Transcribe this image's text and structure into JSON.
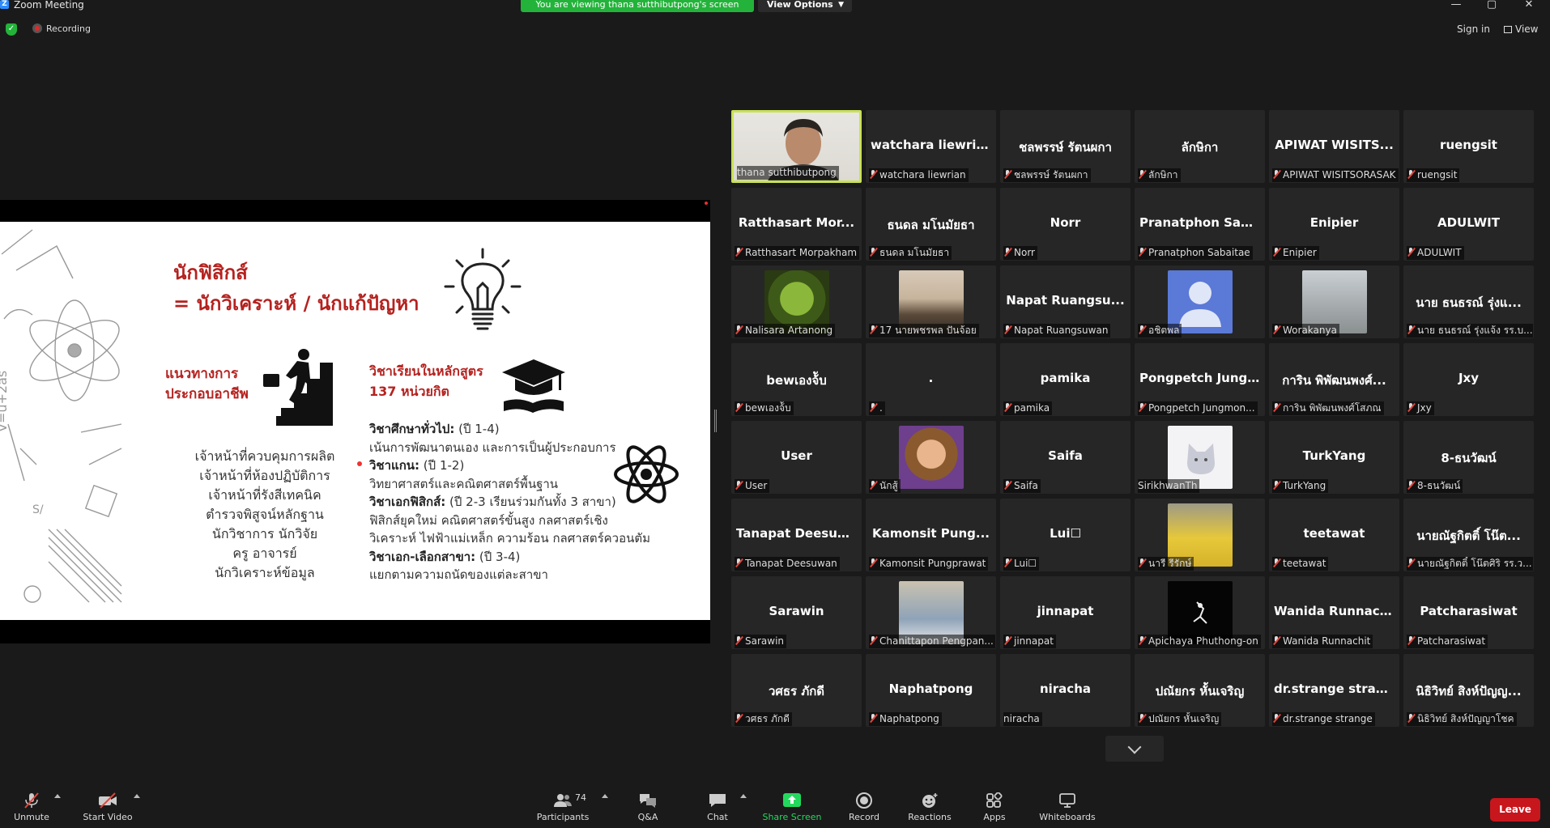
{
  "window": {
    "app_title": "Zoom Meeting",
    "minimize": "—",
    "restore": "▢",
    "close": "✕"
  },
  "banner": {
    "viewing": "You are viewing thana sutthibutpong's screen",
    "view_options": "View Options"
  },
  "topbar": {
    "recording": "Recording",
    "sign_in": "Sign in",
    "view": "View"
  },
  "slide": {
    "title_line1": "นักฟิสิกส์",
    "title_line2": "= นักวิเคราะห์ / นักแก้ปัญหา",
    "career_heading_line1": "แนวทางการ",
    "career_heading_line2": "ประกอบอาชีพ",
    "course_heading_line1": "วิชาเรียนในหลักสูตร",
    "course_heading_line2": "137 หน่วยกิต",
    "careers": [
      "เจ้าหน้าที่ควบคุมการผลิต",
      "เจ้าหน้าที่ห้องปฏิบัติการ",
      "เจ้าหน้าที่รังสีเทคนิค",
      "ตำรวจพิสูจน์หลักฐาน",
      "นักวิชาการ นักวิจัย",
      "ครู อาจารย์",
      "นักวิเคราะห์ข้อมูล"
    ],
    "curriculum": {
      "general_label": "วิชาศึกษาทั่วไป:",
      "general_years": " (ปี 1-4)",
      "general_desc": "เน้นการพัฒนาตนเอง และการเป็นผู้ประกอบการ",
      "core_label": "วิชาแกน:",
      "core_years": " (ปี 1-2)",
      "core_desc": "วิทยาศาสตร์และคณิตศาสตร์พื้นฐาน",
      "major_label": "วิชาเอกฟิสิกส์:",
      "major_years": " (ปี 2-3 เรียนร่วมกันทั้ง 3 สาขา)",
      "major_desc1": "ฟิสิกส์ยุคใหม่ คณิตศาสตร์ขั้นสูง กลศาสตร์เชิง",
      "major_desc2": "วิเคราะห์ ไฟฟ้าแม่เหล็ก ความร้อน กลศาสตร์ควอนตัม",
      "elective_label": "วิชาเอก-เลือกสาขา:",
      "elective_years": " (ปี 3-4)",
      "elective_desc": "แยกตามความถนัดของแต่ละสาขา"
    }
  },
  "participants_grid": [
    {
      "name": "",
      "label": "thana sutthibutpong",
      "muted": false,
      "active": true,
      "avatar": "person"
    },
    {
      "name": "watchara liewrian",
      "label": "watchara liewrian",
      "muted": true
    },
    {
      "name": "ชลพรรษ์ รัตนผกา",
      "label": "ชลพรรษ์ รัตนผกา",
      "muted": true
    },
    {
      "name": "ลักษิกา",
      "label": "ลักษิกา",
      "muted": true
    },
    {
      "name": "APIWAT WISITS...",
      "label": "APIWAT WISITSORASAK",
      "muted": true
    },
    {
      "name": "ruengsit",
      "label": "ruengsit",
      "muted": true
    },
    {
      "name": "Ratthasart Mor...",
      "label": "Ratthasart Morpakham",
      "muted": true
    },
    {
      "name": "ธนดล มโนมัยธา",
      "label": "ธนดล มโนมัยธา",
      "muted": true
    },
    {
      "name": "Norr",
      "label": "Norr",
      "muted": true
    },
    {
      "name": "Pranatphon Sab...",
      "label": "Pranatphon Sabaitae",
      "muted": true
    },
    {
      "name": "Enipier",
      "label": "Enipier",
      "muted": true
    },
    {
      "name": "ADULWIT",
      "label": "ADULWIT",
      "muted": true
    },
    {
      "name": "",
      "label": "Nalisara Artanong",
      "muted": true,
      "avatar": "green"
    },
    {
      "name": "",
      "label": "17 นายพชรพล ปันจ้อย",
      "muted": true,
      "avatar": "sunset"
    },
    {
      "name": "Napat Ruangsu...",
      "label": "Napat Ruangsuwan",
      "muted": true
    },
    {
      "name": "",
      "label": "อชิตพล",
      "muted": true,
      "avatar": "default"
    },
    {
      "name": "",
      "label": "Worakanya",
      "muted": true,
      "avatar": "birds"
    },
    {
      "name": "นาย ธนธรณ์ รุ่งแ...",
      "label": "นาย ธนธรณ์ รุ่งแจ้ง รร.บ...",
      "muted": true
    },
    {
      "name": "bewเองจ้ับ",
      "label": "bewเองจ้ับ",
      "muted": true
    },
    {
      "name": ".",
      "label": ".",
      "muted": true
    },
    {
      "name": "pamika",
      "label": "pamika",
      "muted": true
    },
    {
      "name": "Pongpetch Jung...",
      "label": "Pongpetch Jungmon...",
      "muted": true
    },
    {
      "name": "การิน พิพัฒนพงศ์...",
      "label": "การิน พิพัฒนพงศ์โสภณ",
      "muted": true
    },
    {
      "name": "Jxy",
      "label": "Jxy",
      "muted": true
    },
    {
      "name": "User",
      "label": "User",
      "muted": true
    },
    {
      "name": "",
      "label": "นักสู้",
      "muted": true,
      "avatar": "cartoon"
    },
    {
      "name": "Saifa",
      "label": "Saifa",
      "muted": true
    },
    {
      "name": "",
      "label": "SirikhwanTh",
      "muted": false,
      "avatar": "cat"
    },
    {
      "name": "TurkYang",
      "label": "TurkYang",
      "muted": true
    },
    {
      "name": "8-ธนวัฒน์",
      "label": "8-ธนวัฒน์",
      "muted": true
    },
    {
      "name": "Tanapat Deesuw...",
      "label": "Tanapat Deesuwan",
      "muted": true
    },
    {
      "name": "Kamonsit Pung...",
      "label": "Kamonsit Pungprawat",
      "muted": true
    },
    {
      "name": "Lui☐",
      "label": "Lui☐",
      "muted": true
    },
    {
      "name": "",
      "label": "นารี รีรักษ์",
      "muted": true,
      "avatar": "yellow"
    },
    {
      "name": "teetawat",
      "label": "teetawat",
      "muted": true
    },
    {
      "name": "นายณัฐกิตติ์ โน๊ต...",
      "label": "นายณัฐกิตติ์ โน๊ตศิริ รร.ว...",
      "muted": true
    },
    {
      "name": "Sarawin",
      "label": "Sarawin",
      "muted": true
    },
    {
      "name": "",
      "label": "Chanittapon Pengpan...",
      "muted": true,
      "avatar": "student"
    },
    {
      "name": "jinnapat",
      "label": "jinnapat",
      "muted": true
    },
    {
      "name": "",
      "label": "Apichaya Phuthong-on",
      "muted": true,
      "avatar": "dark"
    },
    {
      "name": "Wanida Runnachit",
      "label": "Wanida Runnachit",
      "muted": true
    },
    {
      "name": "Patcharasiwat",
      "label": "Patcharasiwat",
      "muted": true
    },
    {
      "name": "วศธร ภักดี",
      "label": "วศธร ภักดี",
      "muted": true
    },
    {
      "name": "Naphatpong",
      "label": "Naphatpong",
      "muted": true
    },
    {
      "name": "niracha",
      "label": "niracha",
      "muted": false
    },
    {
      "name": "ปณัยกร หั้นเจริญ",
      "label": "ปณัยกร หั้นเจริญ",
      "muted": true
    },
    {
      "name": "dr.strange strange",
      "label": "dr.strange strange",
      "muted": true
    },
    {
      "name": "นิธิวิทย์ สิงห์ปัญญ...",
      "label": "นิธิวิทย์ สิงห์ปัญญาโชค",
      "muted": true
    }
  ],
  "toolbar": {
    "unmute": "Unmute",
    "start_video": "Start Video",
    "participants": "Participants",
    "participants_count": "74",
    "qa": "Q&A",
    "chat": "Chat",
    "share_screen": "Share Screen",
    "record": "Record",
    "reactions": "Reactions",
    "apps": "Apps",
    "whiteboards": "Whiteboards",
    "leave": "Leave"
  },
  "colors": {
    "banner_green": "#23b33a",
    "share_green": "#23d95d",
    "leave_red": "#c8161d",
    "active_border": "#c9e157",
    "slide_red": "#b5221f",
    "zoom_blue": "#2D8CFF"
  }
}
